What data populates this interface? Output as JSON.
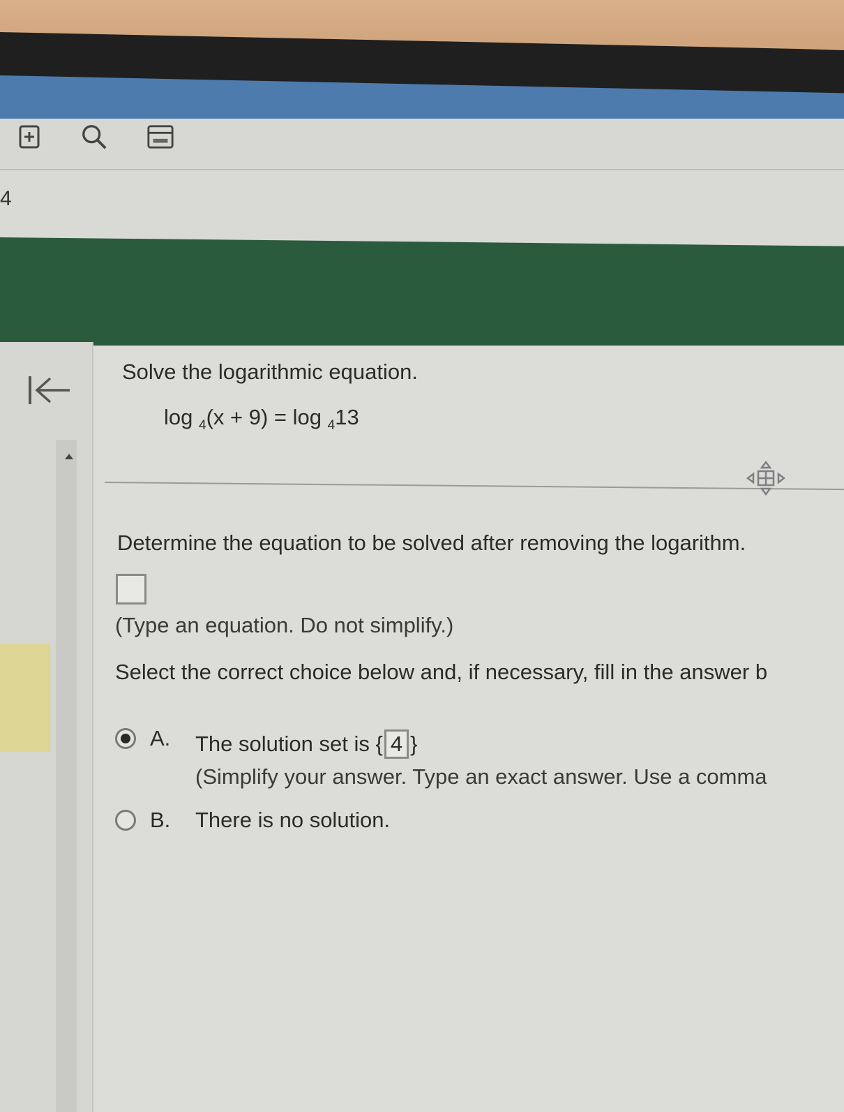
{
  "toolbar": {
    "icons": [
      "add-document-icon",
      "search-icon",
      "calculator-icon"
    ]
  },
  "question": {
    "number": "4",
    "prompt": "Solve the logarithmic equation.",
    "equation": {
      "lhs_fn": "log",
      "lhs_base": "4",
      "lhs_arg": "(x + 9)",
      "equals": "=",
      "rhs_fn": "log",
      "rhs_base": "4",
      "rhs_arg": "13"
    }
  },
  "part1": {
    "instruction": "Determine the equation to be solved after removing the logarithm.",
    "answer_value": "",
    "hint": "(Type an equation. Do not simplify.)"
  },
  "part2": {
    "instruction": "Select the correct choice below and, if necessary, fill in the answer b",
    "choices": [
      {
        "letter": "A.",
        "text": "The solution set is",
        "set_open": "{",
        "set_value": "4",
        "set_close": "}",
        "hint": "(Simplify your answer. Type an exact answer. Use a comma",
        "selected": true
      },
      {
        "letter": "B.",
        "text": "There is no solution.",
        "selected": false
      }
    ]
  }
}
